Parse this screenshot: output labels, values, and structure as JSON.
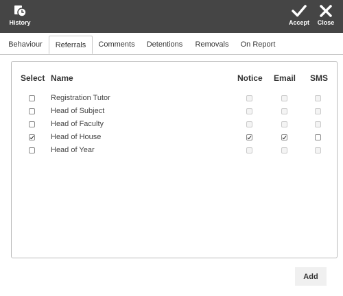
{
  "toolbar": {
    "history_label": "History",
    "accept_label": "Accept",
    "close_label": "Close",
    "history_icon": "history-icon",
    "accept_icon": "checkmark-icon",
    "close_icon": "close-icon",
    "background_color": "#454545"
  },
  "tabs": [
    {
      "label": "Behaviour",
      "active": false
    },
    {
      "label": "Referrals",
      "active": true
    },
    {
      "label": "Comments",
      "active": false
    },
    {
      "label": "Detentions",
      "active": false
    },
    {
      "label": "Removals",
      "active": false
    },
    {
      "label": "On Report",
      "active": false
    }
  ],
  "table": {
    "headers": {
      "select": "Select",
      "name": "Name",
      "notice": "Notice",
      "email": "Email",
      "sms": "SMS"
    },
    "rows": [
      {
        "name": "Registration Tutor",
        "selected": false,
        "notice": false,
        "email": false,
        "sms": false,
        "options_enabled": false
      },
      {
        "name": "Head of Subject",
        "selected": false,
        "notice": false,
        "email": false,
        "sms": false,
        "options_enabled": false
      },
      {
        "name": "Head of Faculty",
        "selected": false,
        "notice": false,
        "email": false,
        "sms": false,
        "options_enabled": false
      },
      {
        "name": "Head of House",
        "selected": true,
        "notice": true,
        "email": true,
        "sms": false,
        "options_enabled": true
      },
      {
        "name": "Head of Year",
        "selected": false,
        "notice": false,
        "email": false,
        "sms": false,
        "options_enabled": false
      }
    ]
  },
  "footer": {
    "add_label": "Add"
  }
}
